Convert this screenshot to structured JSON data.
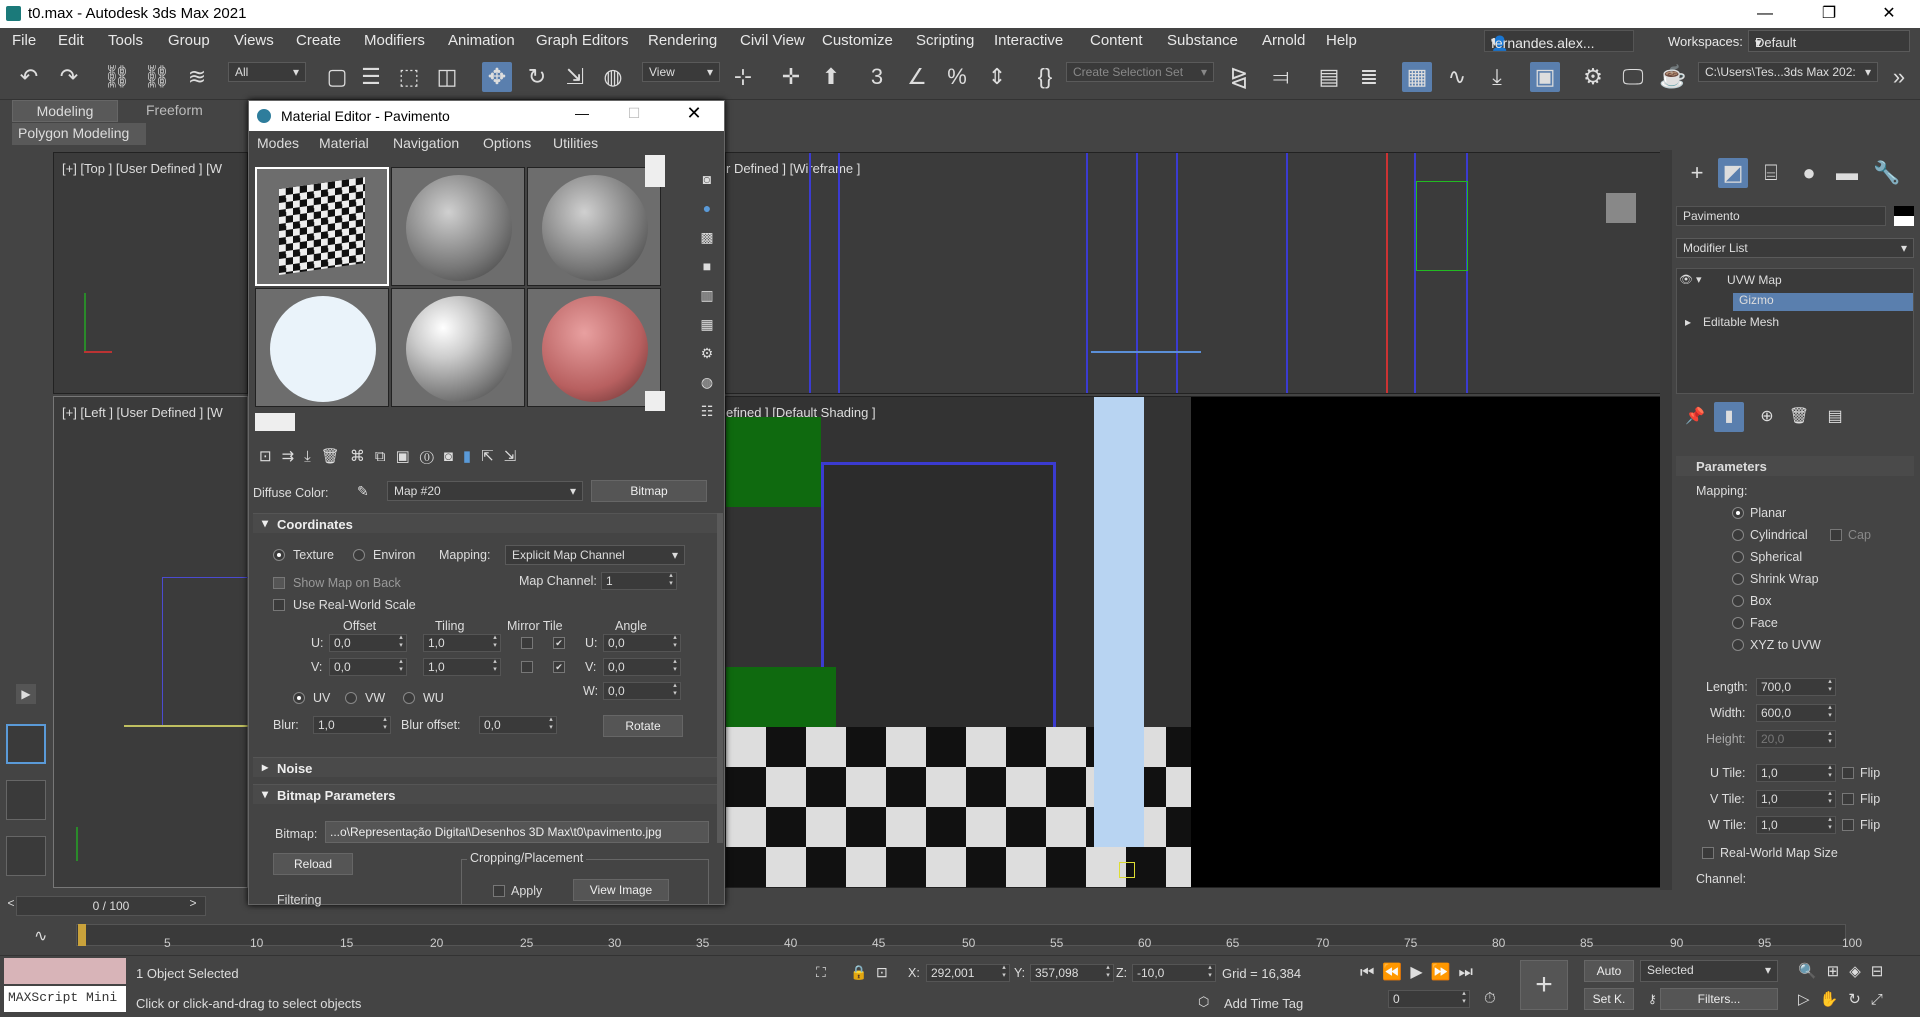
{
  "window": {
    "title": "t0.max - Autodesk 3ds Max 2021"
  },
  "menus": [
    "File",
    "Edit",
    "Tools",
    "Group",
    "Views",
    "Create",
    "Modifiers",
    "Animation",
    "Graph Editors",
    "Rendering",
    "Civil View",
    "Customize",
    "Scripting",
    "Interactive",
    "Content",
    "Substance",
    "Arnold",
    "Help"
  ],
  "user": "fernandes.alex...",
  "workspaces": {
    "label": "Workspaces:",
    "value": "Default"
  },
  "toolbar": {
    "filter": "All",
    "refcoord": "View",
    "selection_set": "Create Selection Set",
    "project_path": "C:\\Users\\Tes...3ds Max 202:"
  },
  "ribbon": {
    "tab1": "Modeling",
    "tab2": "Freeform",
    "sub": "Polygon Modeling"
  },
  "viewports": {
    "top": "[+] [Top ] [User Defined ] [W",
    "front_tail": "r Defined ] [Wireframe ]",
    "left": "[+] [Left ] [User Defined ] [W",
    "persp_tail": "efined ] [Default Shading ]"
  },
  "material_editor": {
    "title": "Material Editor - Pavimento",
    "menus": [
      "Modes",
      "Material",
      "Navigation",
      "Options",
      "Utilities"
    ],
    "diffuse_label": "Diffuse Color:",
    "map_name": "Map #20",
    "map_type": "Bitmap",
    "coordinates": {
      "title": "Coordinates",
      "texture": "Texture",
      "environ": "Environ",
      "mapping_label": "Mapping:",
      "mapping_value": "Explicit Map Channel",
      "show_map_on_back": "Show Map on Back",
      "map_channel_label": "Map Channel:",
      "map_channel": "1",
      "real_world": "Use Real-World Scale",
      "h_offset": "Offset",
      "h_tiling": "Tiling",
      "h_mirror_tile": "Mirror Tile",
      "h_angle": "Angle",
      "u_label": "U:",
      "v_label": "V:",
      "w_label": "W:",
      "u_offset": "0,0",
      "v_offset": "0,0",
      "u_tiling": "1,0",
      "v_tiling": "1,0",
      "u_angle": "0,0",
      "v_angle": "0,0",
      "w_angle": "0,0",
      "uv": "UV",
      "vw": "VW",
      "wu": "WU",
      "blur_label": "Blur:",
      "blur": "1,0",
      "blur_offset_label": "Blur offset:",
      "blur_offset": "0,0",
      "rotate": "Rotate"
    },
    "noise": "Noise",
    "bitmap_params": {
      "title": "Bitmap Parameters",
      "bitmap_label": "Bitmap:",
      "path": "...o\\Representação Digital\\Desenhos 3D Max\\t0\\pavimento.jpg",
      "reload": "Reload",
      "cropping": "Cropping/Placement",
      "apply": "Apply",
      "view_image": "View Image",
      "filtering": "Filtering"
    }
  },
  "command_panel": {
    "object_name": "Pavimento",
    "modifier_list": "Modifier List",
    "stack": [
      "UVW Map",
      "Gizmo",
      "Editable Mesh"
    ],
    "parameters": "Parameters",
    "mapping": "Mapping:",
    "mapping_types": [
      "Planar",
      "Cylindrical",
      "Spherical",
      "Shrink Wrap",
      "Box",
      "Face",
      "XYZ to UVW"
    ],
    "cap": "Cap",
    "length_label": "Length:",
    "length": "700,0",
    "width_label": "Width:",
    "width": "600,0",
    "height_label": "Height:",
    "height": "20,0",
    "utile_label": "U Tile:",
    "utile": "1,0",
    "vtile_label": "V Tile:",
    "vtile": "1,0",
    "wtile_label": "W Tile:",
    "wtile": "1,0",
    "flip": "Flip",
    "real_world": "Real-World Map Size",
    "channel": "Channel:"
  },
  "timeline": {
    "frame": "0 / 100",
    "ticks": [
      "5",
      "10",
      "15",
      "20",
      "25",
      "30",
      "35",
      "40",
      "45",
      "50",
      "55",
      "60",
      "65",
      "70",
      "75",
      "80",
      "85",
      "90",
      "95",
      "100"
    ]
  },
  "status": {
    "maxscript": "MAXScript Mini",
    "selected": "1 Object Selected",
    "prompt": "Click or click-and-drag to select objects",
    "x_label": "X:",
    "x": "292,001",
    "y_label": "Y:",
    "y": "357,098",
    "z_label": "Z:",
    "z": "-10,0",
    "grid": "Grid = 16,384",
    "add_time_tag": "Add Time Tag",
    "auto": "Auto",
    "set_key": "Set K.",
    "selected_dd": "Selected",
    "filters": "Filters...",
    "frame_field": "0"
  }
}
